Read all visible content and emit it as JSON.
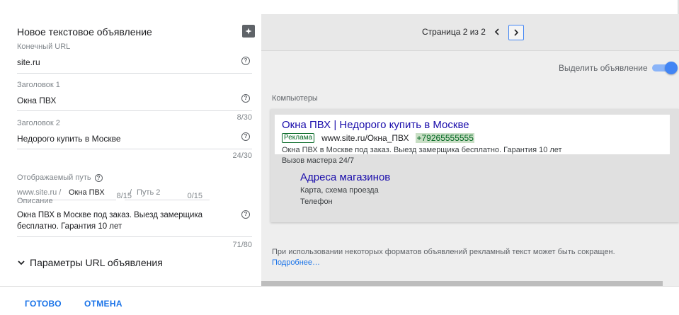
{
  "form": {
    "title": "Новое текстовое объявление",
    "final_url": {
      "label": "Конечный URL",
      "value": "site.ru"
    },
    "headline1": {
      "label": "Заголовок 1",
      "value": "Окна ПВХ",
      "counter": "8/30"
    },
    "headline2": {
      "label": "Заголовок 2",
      "value": "Недорого купить в Москве",
      "counter": "24/30"
    },
    "display_path": {
      "label": "Отображаемый путь",
      "domain": "www.site.ru /",
      "path1": "Окна ПВХ",
      "separator": "/",
      "path2_placeholder": "Путь 2",
      "path1_counter": "8/15",
      "path2_counter": "0/15"
    },
    "description": {
      "label": "Описание",
      "line1": "Окна ПВХ в Москве под заказ. Выезд замерщика",
      "line2": "бесплатно. Гарантия 10 лет",
      "counter": "71/80"
    },
    "url_params": "Параметры URL объявления"
  },
  "preview": {
    "pager": "Страница 2 из 2",
    "highlight_label": "Выделить объявление",
    "device": "Компьютеры",
    "ad": {
      "headline": "Окна ПВХ | Недорого купить в Москве",
      "badge": "Реклама",
      "url": "www.site.ru/Окна_ПВХ",
      "phone": "+79265555555",
      "description": "Окна ПВХ в Москве под заказ. Выезд замерщика бесплатно. Гарантия 10 лет",
      "extra": "Вызов мастера 24/7",
      "sitelink": {
        "title": "Адреса магазинов",
        "line1": "Карта, схема проезда",
        "line2": "Телефон"
      }
    },
    "notice": "При использовании некоторых форматов объявлений рекламный текст может быть сокращен.",
    "notice_link": "Подробнее…"
  },
  "footer": {
    "done": "ГОТОВО",
    "cancel": "ОТМЕНА"
  },
  "colors": {
    "accent": "#1a73e8",
    "ad_headline": "#1a0dab",
    "ad_green": "#006621",
    "toggle": "#4285f4"
  },
  "icons": {
    "tip": "lightbulb-icon",
    "help": "help-circle-icon",
    "chevron_down": "chevron-down-icon",
    "prev": "chevron-left-icon",
    "next": "chevron-right-icon"
  }
}
